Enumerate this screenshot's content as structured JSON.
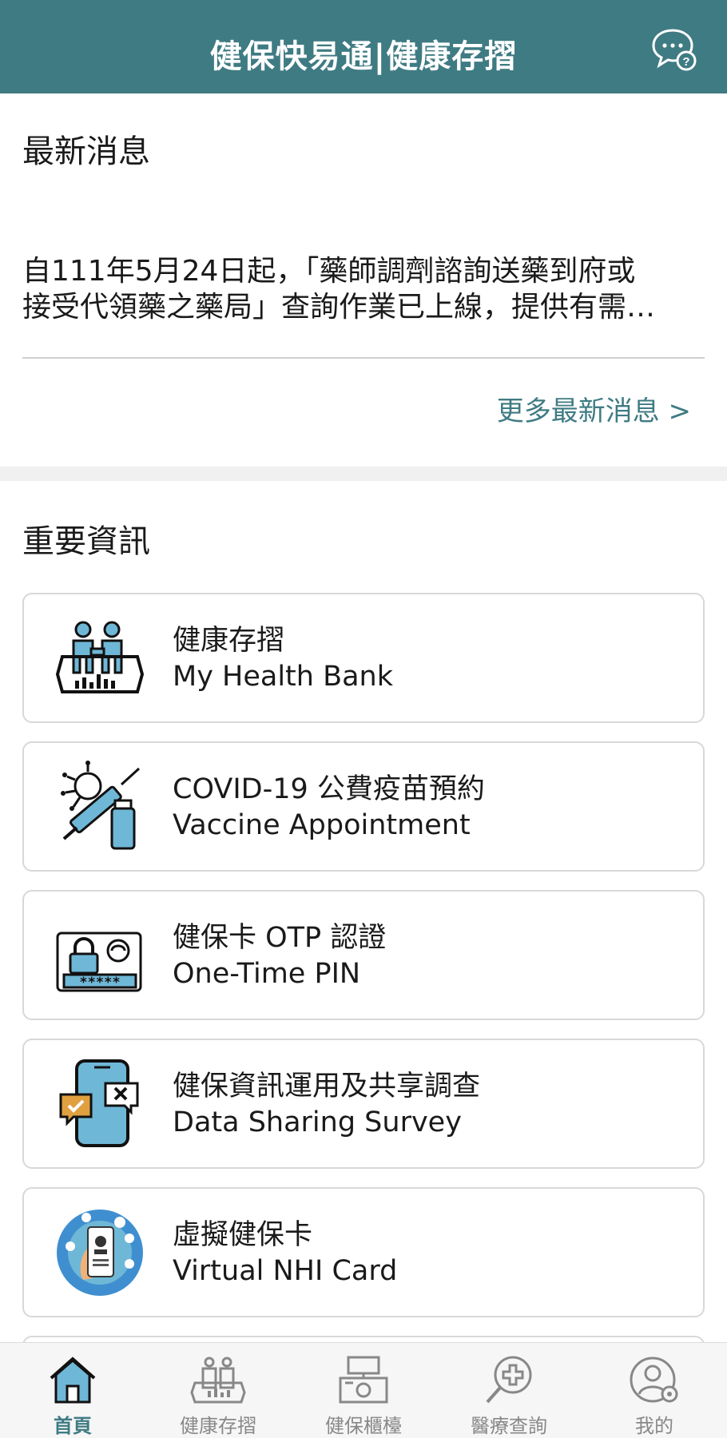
{
  "header": {
    "title": "健保快易通|健康存摺",
    "chat_icon": "chat-help-icon"
  },
  "news": {
    "title": "最新消息",
    "lines": [
      "自111年5月24日起，「藥師調劑諮詢送藥到府或",
      "接受代領藥之藥局」查詢作業已上線，提供有需…"
    ],
    "more_link": "更多最新消息 >"
  },
  "important": {
    "title": "重要資訊",
    "cards": [
      {
        "zh": "健康存摺",
        "en": "My Health Bank",
        "icon": "health-bank-icon"
      },
      {
        "zh": "COVID-19 公費疫苗預約",
        "en": "Vaccine Appointment",
        "icon": "vaccine-icon"
      },
      {
        "zh": "健保卡 OTP 認證",
        "en": "One-Time PIN",
        "icon": "otp-lock-icon"
      },
      {
        "zh": "健保資訊運用及共享調查",
        "en": "Data Sharing Survey",
        "icon": "survey-phone-icon"
      },
      {
        "zh": "虛擬健保卡",
        "en": "Virtual NHI Card",
        "icon": "virtual-card-icon"
      }
    ]
  },
  "tabs": [
    {
      "label": "首頁",
      "icon": "home-icon"
    },
    {
      "label": "健康存摺",
      "icon": "health-bank-tab-icon"
    },
    {
      "label": "健保櫃檯",
      "icon": "counter-icon"
    },
    {
      "label": "醫療查詢",
      "icon": "medical-search-icon"
    },
    {
      "label": "我的",
      "icon": "profile-settings-icon"
    }
  ],
  "colors": {
    "brand": "#3f7b83",
    "icon_blue": "#6fb7d6",
    "icon_orange": "#e0a040"
  }
}
